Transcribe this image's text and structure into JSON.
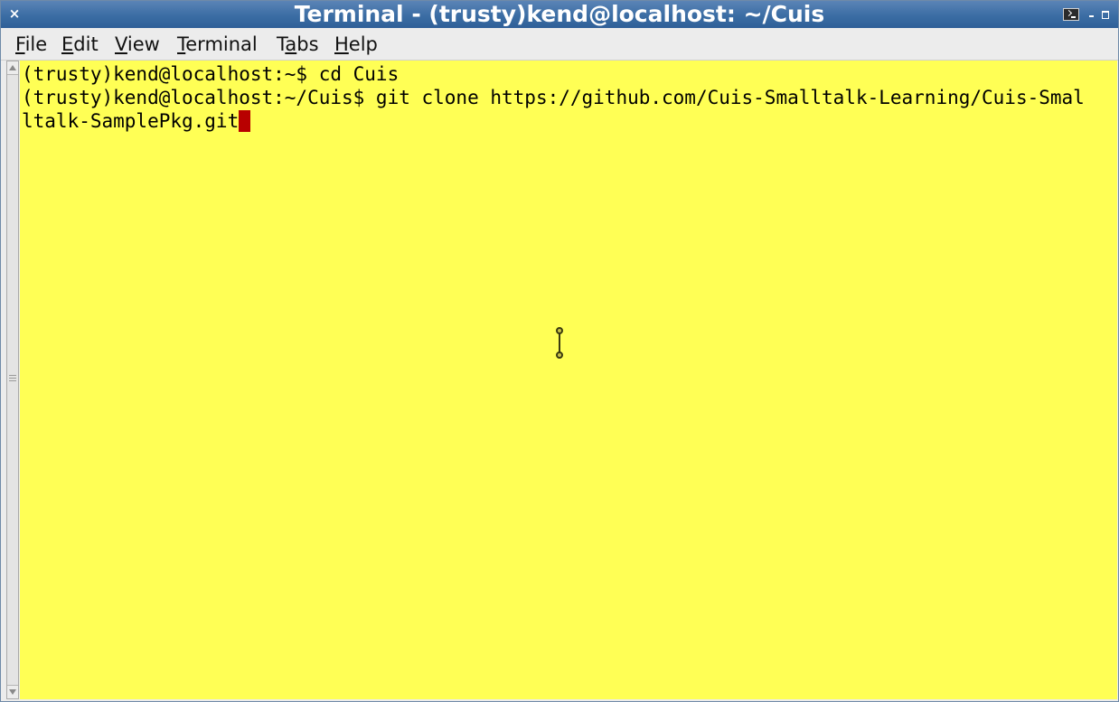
{
  "window": {
    "title": "Terminal - (trusty)kend@localhost: ~/Cuis",
    "close_glyph": "×",
    "icons": [
      "terminal-icon",
      "minimize-icon",
      "maximize-icon"
    ]
  },
  "menubar": {
    "items": [
      {
        "label_mnemonic": "F",
        "label_rest": "ile"
      },
      {
        "label_mnemonic": "E",
        "label_rest": "dit"
      },
      {
        "label_mnemonic": "V",
        "label_rest": "iew"
      },
      {
        "label_mnemonic": "T",
        "label_rest": "erminal"
      },
      {
        "label_prefix": "T",
        "label_mnemonic": "a",
        "label_rest": "bs"
      },
      {
        "label_mnemonic": "H",
        "label_rest": "elp"
      }
    ]
  },
  "terminal": {
    "background": "#ffff55",
    "cursor_color": "#b80000",
    "lines": [
      "(trusty)kend@localhost:~$ cd Cuis",
      "(trusty)kend@localhost:~/Cuis$ git clone https://github.com/Cuis-Smalltalk-Learning/Cuis-Smal",
      "ltalk-SamplePkg.git"
    ]
  }
}
